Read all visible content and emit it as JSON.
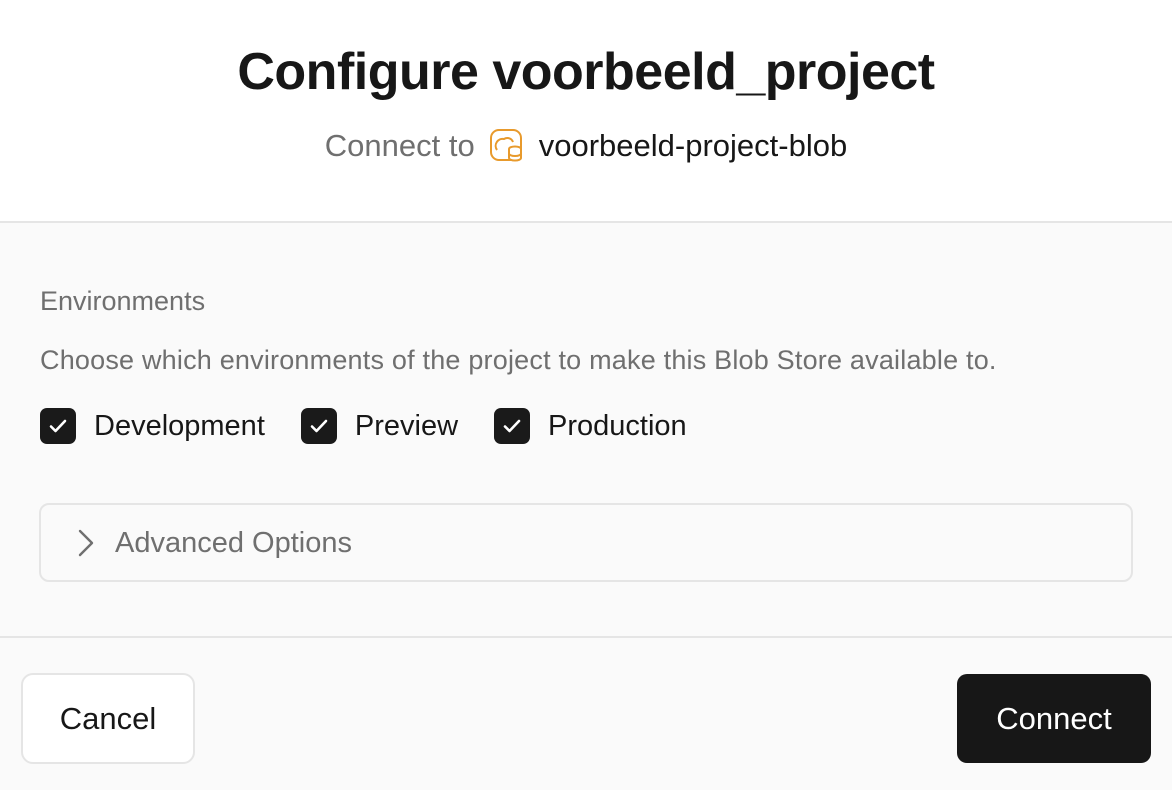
{
  "dialog": {
    "title": "Configure voorbeeld_project",
    "subtitle_prefix": "Connect to",
    "store_icon": "blob-storage-icon",
    "store_name": "voorbeeld-project-blob",
    "accent_color": "#e89a2c"
  },
  "environments": {
    "label": "Environments",
    "description": "Choose which environments of the project to make this Blob Store available to.",
    "options": [
      {
        "label": "Development",
        "checked": true
      },
      {
        "label": "Preview",
        "checked": true
      },
      {
        "label": "Production",
        "checked": true
      }
    ]
  },
  "advanced": {
    "label": "Advanced Options",
    "icon": "chevron-right-icon",
    "expanded": false
  },
  "footer": {
    "cancel_label": "Cancel",
    "connect_label": "Connect"
  }
}
